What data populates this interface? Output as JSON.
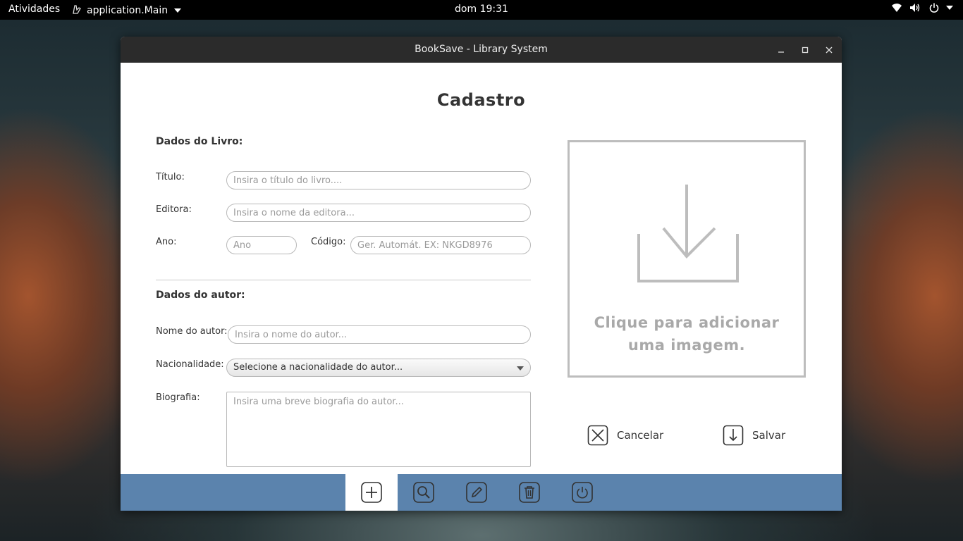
{
  "topbar": {
    "activities": "Atividades",
    "app_name": "application.Main",
    "clock": "dom 19:31"
  },
  "window": {
    "title": "BookSave - Library System"
  },
  "form": {
    "heading": "Cadastro",
    "book_section": "Dados do Livro:",
    "title_label": "Título:",
    "title_placeholder": "Insira o título do livro....",
    "publisher_label": "Editora:",
    "publisher_placeholder": "Insira o nome da editora...",
    "year_label": "Ano:",
    "year_placeholder": "Ano",
    "code_label": "Código:",
    "code_placeholder": "Ger. Automát. EX: NKGD8976",
    "author_section": "Dados do autor:",
    "author_name_label": "Nome do autor:",
    "author_name_placeholder": "Insira o nome do autor...",
    "nationality_label": "Nacionalidade:",
    "nationality_selected": "Selecione a nacionalidade do autor...",
    "bio_label": "Biografia:",
    "bio_placeholder": "Insira uma breve biografia do autor..."
  },
  "image_upload": {
    "line1": "Clique para adicionar",
    "line2": "uma imagem."
  },
  "actions": {
    "cancel": "Cancelar",
    "save": "Salvar"
  },
  "toolbar": {
    "items": [
      "add-icon",
      "search-icon",
      "edit-icon",
      "trash-icon",
      "power-icon"
    ],
    "active": "add-icon"
  },
  "colors": {
    "toolbar_bg": "#5b83ad",
    "titlebar_bg": "#2b2b2b",
    "placeholder": "#9a9a9a"
  }
}
